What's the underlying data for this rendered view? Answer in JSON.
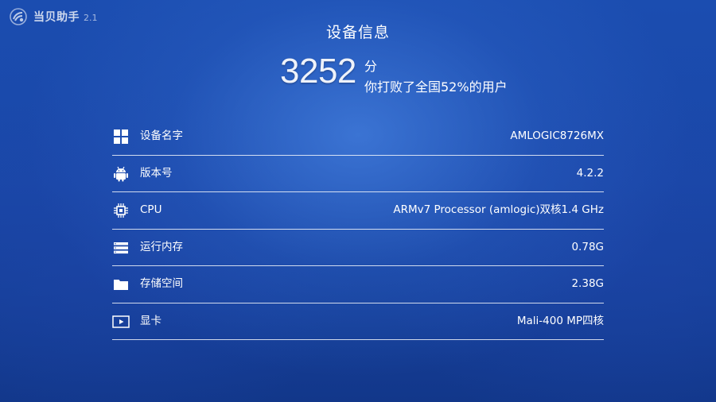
{
  "app": {
    "name": "当贝助手",
    "version": "2.1",
    "logo_icon": "dangbei-logo-icon"
  },
  "page": {
    "title": "设备信息"
  },
  "score": {
    "value": "3252",
    "unit": "分",
    "rank_text": "你打败了全国52%的用户"
  },
  "device_info": [
    {
      "icon": "grid-icon",
      "label": "设备名字",
      "value": "AMLOGIC8726MX"
    },
    {
      "icon": "android-icon",
      "label": "版本号",
      "value": "4.2.2"
    },
    {
      "icon": "cpu-chip-icon",
      "label": "CPU",
      "value": "ARMv7 Processor (amlogic)双核1.4 GHz"
    },
    {
      "icon": "memory-icon",
      "label": "运行内存",
      "value": "0.78G"
    },
    {
      "icon": "folder-icon",
      "label": "存储空间",
      "value": "2.38G"
    },
    {
      "icon": "display-card-icon",
      "label": "显卡",
      "value": "Mali-400 MP四核"
    }
  ],
  "colors": {
    "background": "#1a47a8",
    "text": "#ffffff",
    "divider": "#ffffff"
  }
}
